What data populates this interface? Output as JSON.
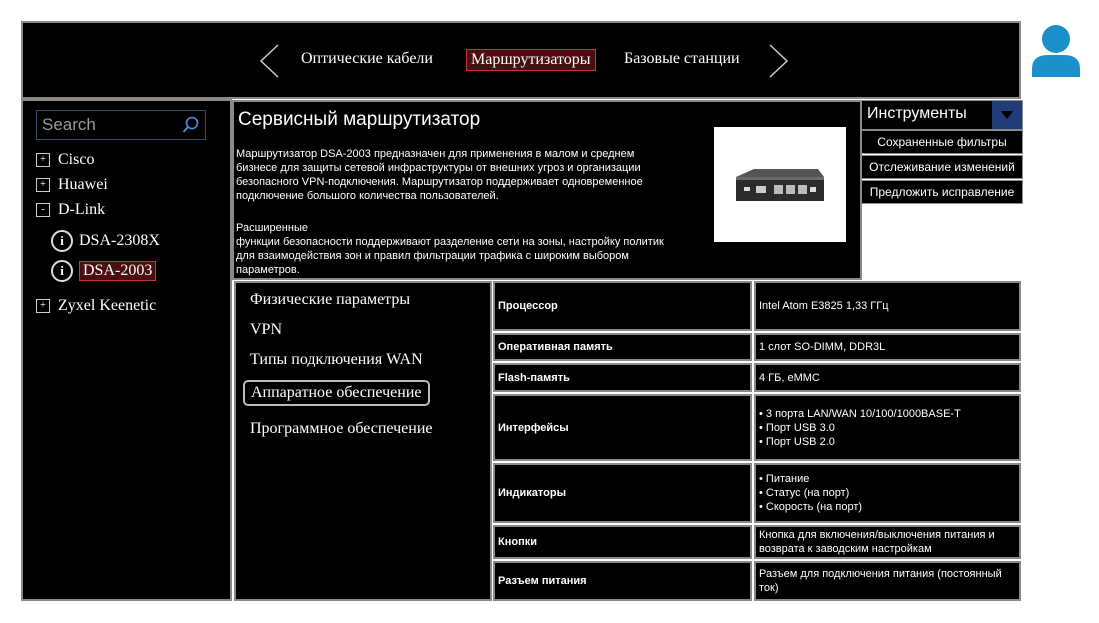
{
  "nav": {
    "tabs": [
      {
        "label": "Оптические кабели",
        "active": false
      },
      {
        "label": "Маршрутизаторы",
        "active": true
      },
      {
        "label": "Базовые станции",
        "active": false
      }
    ],
    "prev_icon": "chevron-left-icon",
    "next_icon": "chevron-right-icon"
  },
  "user": {
    "icon": "user-avatar-icon",
    "color": "#1a8fc9"
  },
  "sidebar": {
    "search_placeholder": "Search",
    "tree": [
      {
        "label": "Cisco",
        "toggle": "+"
      },
      {
        "label": "Huawei",
        "toggle": "+"
      },
      {
        "label": "D-Link",
        "toggle": "-"
      },
      {
        "label": "Zyxel Keenetic",
        "toggle": "+"
      }
    ],
    "dlink_children": [
      {
        "label": "DSA-2308X",
        "icon": "i",
        "active": false
      },
      {
        "label": "DSA-2003",
        "icon": "i",
        "active": true
      }
    ]
  },
  "product": {
    "title": "Сервисный маршрутизатор",
    "paragraph1": "Маршрутизатор DSA-2003 предназначен для применения в малом и среднем бизнесе для защиты сетевой инфраструктуры от внешних угроз и организации безопасного VPN-подключения. Маршрутизатор поддерживает одновременное подключение большого количества пользователей.",
    "paragraph2": "Расширенные\nфункции безопасности поддерживают разделение сети на зоны, настройку политик для взаимодействия зон и правил фильтрации трафика с широким выбором параметров."
  },
  "tools": {
    "label": "Инструменты",
    "items": [
      "Сохраненные фильтры",
      "Отслеживание изменений",
      "Предложить исправление"
    ],
    "accent": "#1f3b78"
  },
  "sections": [
    {
      "label": "Физические параметры",
      "active": false
    },
    {
      "label": "VPN",
      "active": false
    },
    {
      "label": "Типы подключения WAN",
      "active": false
    },
    {
      "label": "Аппаратное обеспечение",
      "active": true
    },
    {
      "label": "Программное обеспечение",
      "active": false
    }
  ],
  "specs": [
    {
      "label": "Процессор",
      "value": "Intel Atom E3825 1,33 ГГц"
    },
    {
      "label": "Оперативная память",
      "value": "1 слот SO-DIMM, DDR3L"
    },
    {
      "label": "Flash-память",
      "value": "4 ГБ, eMMC"
    },
    {
      "label": "Интерфейсы",
      "value": "• 3 порта LAN/WAN 10/100/1000BASE-T\n• Порт USB 3.0\n• Порт USB 2.0"
    },
    {
      "label": "Индикаторы",
      "value": "• Питание\n• Статус (на порт)\n• Скорость (на порт)"
    },
    {
      "label": "Кнопки",
      "value": "Кнопка для включения/выключения питания и возврата к заводским настройкам"
    },
    {
      "label": "Разъем питания",
      "value": "Разъем для подключения питания (постоянный ток)"
    }
  ],
  "colors": {
    "active_bg": "#4a0f10",
    "active_border": "#c0393a"
  }
}
